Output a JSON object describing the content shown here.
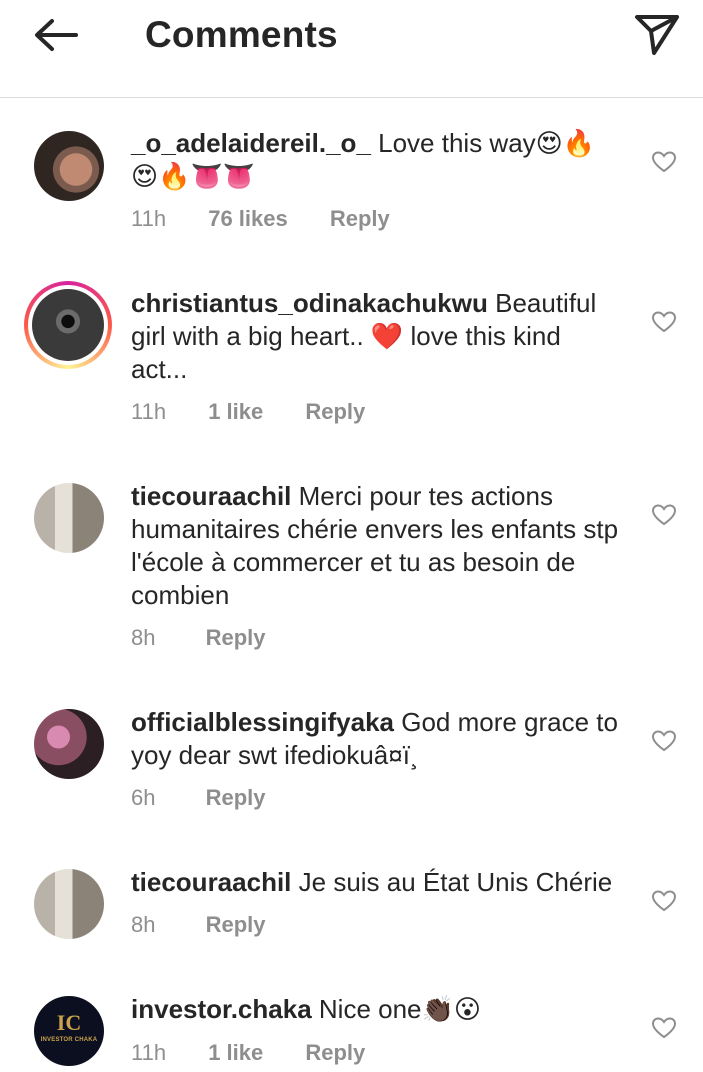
{
  "header": {
    "title": "Comments",
    "back_icon": "back-arrow-icon",
    "send_icon": "send-icon"
  },
  "comments": [
    {
      "username": "_o_adelaidereil._o_",
      "text": "Love this way😍🔥😍🔥👅👅",
      "time": "11h",
      "likes": "76 likes",
      "reply": "Reply"
    },
    {
      "username": "christiantus_odinakachukwu",
      "text": "Beautiful girl with a big heart.. ❤️ love this kind act...",
      "time": "11h",
      "likes": "1 like",
      "reply": "Reply"
    },
    {
      "username": "tiecouraachil",
      "text": "Merci pour tes actions humanitaires chérie envers les enfants stp l'école à commercer et tu as besoin de combien",
      "time": "8h",
      "likes": "",
      "reply": "Reply"
    },
    {
      "username": "officialblessingifyaka",
      "text": "God more grace to yoy dear swt ifediokuâ¤ï¸",
      "time": "6h",
      "likes": "",
      "reply": "Reply"
    },
    {
      "username": "tiecouraachil",
      "text": "Je suis au État Unis Chérie",
      "time": "8h",
      "likes": "",
      "reply": "Reply"
    },
    {
      "username": "investor.chaka",
      "text": "Nice one👏🏿😮",
      "time": "11h",
      "likes": "1 like",
      "reply": "Reply",
      "avatar_text": "IC",
      "avatar_subtext": "INVESTOR CHAKA"
    }
  ]
}
